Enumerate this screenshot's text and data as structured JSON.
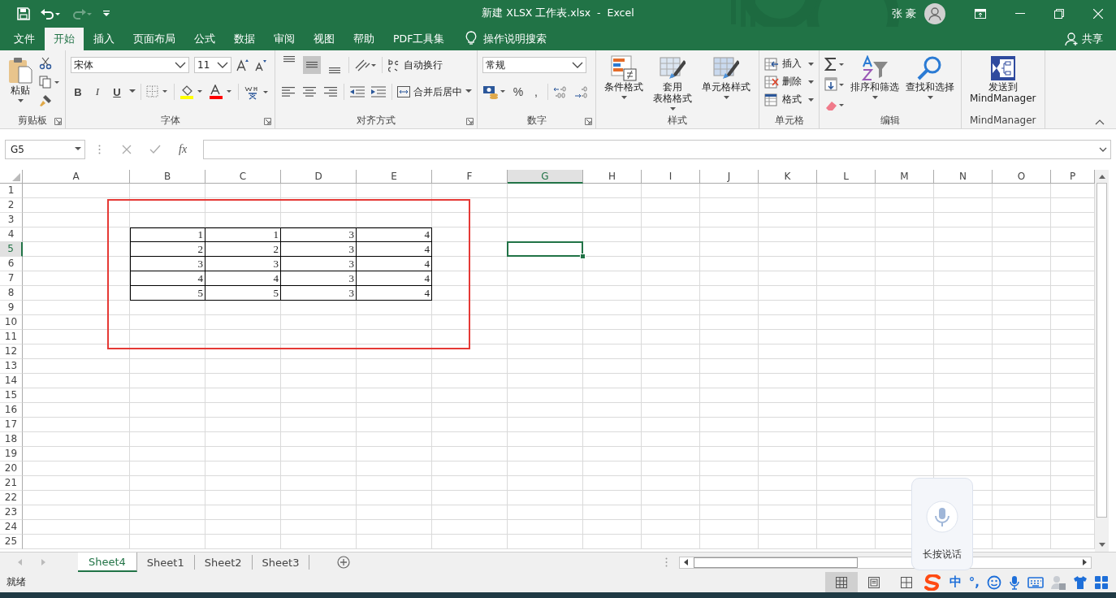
{
  "title_bar": {
    "title": "新建 XLSX 工作表.xlsx  -  Excel",
    "user": "张 豪",
    "redo_disabled": true
  },
  "menu_tabs": [
    {
      "label": "文件",
      "selected": false
    },
    {
      "label": "开始",
      "selected": true
    },
    {
      "label": "插入",
      "selected": false
    },
    {
      "label": "页面布局",
      "selected": false
    },
    {
      "label": "公式",
      "selected": false
    },
    {
      "label": "数据",
      "selected": false
    },
    {
      "label": "审阅",
      "selected": false
    },
    {
      "label": "视图",
      "selected": false
    },
    {
      "label": "帮助",
      "selected": false
    },
    {
      "label": "PDF工具集",
      "selected": false
    }
  ],
  "tell_me": "操作说明搜索",
  "share": "共享",
  "ribbon": [
    {
      "kind": "clipboard",
      "label": "剪贴板",
      "paste": "粘贴",
      "launcher": true
    },
    {
      "kind": "font",
      "label": "字体",
      "font_name": "宋体",
      "font_size": "11",
      "bold": "B",
      "italic": "I",
      "underline": "U",
      "launcher": true
    },
    {
      "kind": "alignment",
      "label": "对齐方式",
      "vertical_align": [
        {
          "selected": false
        },
        {
          "selected": true
        },
        {
          "selected": false
        }
      ],
      "wrap": "自动换行",
      "merge": "合并后居中",
      "launcher": true
    },
    {
      "kind": "number",
      "label": "数字",
      "format": "常规",
      "percent": "%",
      "comma": ",",
      "launcher": true
    },
    {
      "kind": "styles",
      "label": "样式",
      "buttons": [
        {
          "lines": [
            "条件格式"
          ]
        },
        {
          "lines": [
            "套用",
            "表格格式"
          ]
        },
        {
          "lines": [
            "单元格样式"
          ]
        }
      ]
    },
    {
      "kind": "cells",
      "label": "单元格",
      "buttons": [
        "插入",
        "删除",
        "格式"
      ]
    },
    {
      "kind": "editing",
      "label": "编辑",
      "buttons": [
        "排序和筛选",
        "查找和选择"
      ]
    },
    {
      "kind": "mindmanager",
      "label": "MindManager",
      "button": [
        "发送到",
        "MindManager"
      ]
    }
  ],
  "formula_bar": {
    "name_box": "G5",
    "fx": "fx"
  },
  "sheet": {
    "columns": [
      {
        "label": "A",
        "selected": false
      },
      {
        "label": "B",
        "selected": false
      },
      {
        "label": "C",
        "selected": false
      },
      {
        "label": "D",
        "selected": false
      },
      {
        "label": "E",
        "selected": false
      },
      {
        "label": "F",
        "selected": false
      },
      {
        "label": "G",
        "selected": true
      },
      {
        "label": "H",
        "selected": false
      },
      {
        "label": "I",
        "selected": false
      },
      {
        "label": "J",
        "selected": false
      },
      {
        "label": "K",
        "selected": false
      },
      {
        "label": "L",
        "selected": false
      },
      {
        "label": "M",
        "selected": false
      },
      {
        "label": "N",
        "selected": false
      },
      {
        "label": "O",
        "selected": false
      },
      {
        "label": "P",
        "selected": false
      }
    ],
    "rows": [
      {
        "header": "1",
        "selected": false
      },
      {
        "header": "2",
        "selected": false
      },
      {
        "header": "3",
        "selected": false
      },
      {
        "header": "4",
        "selected": false,
        "cells": [
          {
            "value": "1",
            "bordered": true
          },
          {
            "value": "1",
            "bordered": true
          },
          {
            "value": "3",
            "bordered": true
          },
          {
            "value": "4",
            "bordered": true
          }
        ]
      },
      {
        "header": "5",
        "selected": true,
        "cells": [
          {
            "value": "2",
            "bordered": true
          },
          {
            "value": "2",
            "bordered": true
          },
          {
            "value": "3",
            "bordered": true
          },
          {
            "value": "4",
            "bordered": true
          }
        ]
      },
      {
        "header": "6",
        "selected": false,
        "cells": [
          {
            "value": "3",
            "bordered": true
          },
          {
            "value": "3",
            "bordered": true
          },
          {
            "value": "3",
            "bordered": true
          },
          {
            "value": "4",
            "bordered": true
          }
        ]
      },
      {
        "header": "7",
        "selected": false,
        "cells": [
          {
            "value": "4",
            "bordered": true
          },
          {
            "value": "4",
            "bordered": true
          },
          {
            "value": "3",
            "bordered": true
          },
          {
            "value": "4",
            "bordered": true
          }
        ]
      },
      {
        "header": "8",
        "selected": false,
        "cells": [
          {
            "value": "5",
            "bordered": true
          },
          {
            "value": "5",
            "bordered": true
          },
          {
            "value": "3",
            "bordered": true
          },
          {
            "value": "4",
            "bordered": true
          }
        ]
      },
      {
        "header": "9",
        "selected": false
      },
      {
        "header": "10",
        "selected": false
      },
      {
        "header": "11",
        "selected": false
      },
      {
        "header": "12",
        "selected": false
      },
      {
        "header": "13",
        "selected": false
      },
      {
        "header": "14",
        "selected": false
      },
      {
        "header": "15",
        "selected": false
      },
      {
        "header": "16",
        "selected": false
      },
      {
        "header": "17",
        "selected": false
      },
      {
        "header": "18",
        "selected": false
      },
      {
        "header": "19",
        "selected": false
      },
      {
        "header": "20",
        "selected": false
      },
      {
        "header": "21",
        "selected": false
      },
      {
        "header": "22",
        "selected": false
      },
      {
        "header": "23",
        "selected": false
      },
      {
        "header": "24",
        "selected": false
      },
      {
        "header": "25",
        "selected": false
      }
    ],
    "annotations": [
      {
        "kind": "rectangle"
      }
    ]
  },
  "sheet_tabs": [
    {
      "label": "Sheet4",
      "selected": true
    },
    {
      "label": "Sheet1",
      "selected": false
    },
    {
      "label": "Sheet2",
      "selected": false
    },
    {
      "label": "Sheet3",
      "selected": false
    }
  ],
  "status_bar": {
    "text": "就绪",
    "views": [
      {
        "kind": "normal",
        "selected": true
      },
      {
        "kind": "page_layout",
        "selected": false
      },
      {
        "kind": "page_break",
        "selected": false
      }
    ]
  },
  "ime_toolbar": {
    "mode": "中",
    "punctuation": "°,"
  },
  "ime_popup": {
    "text": "长按说话"
  }
}
